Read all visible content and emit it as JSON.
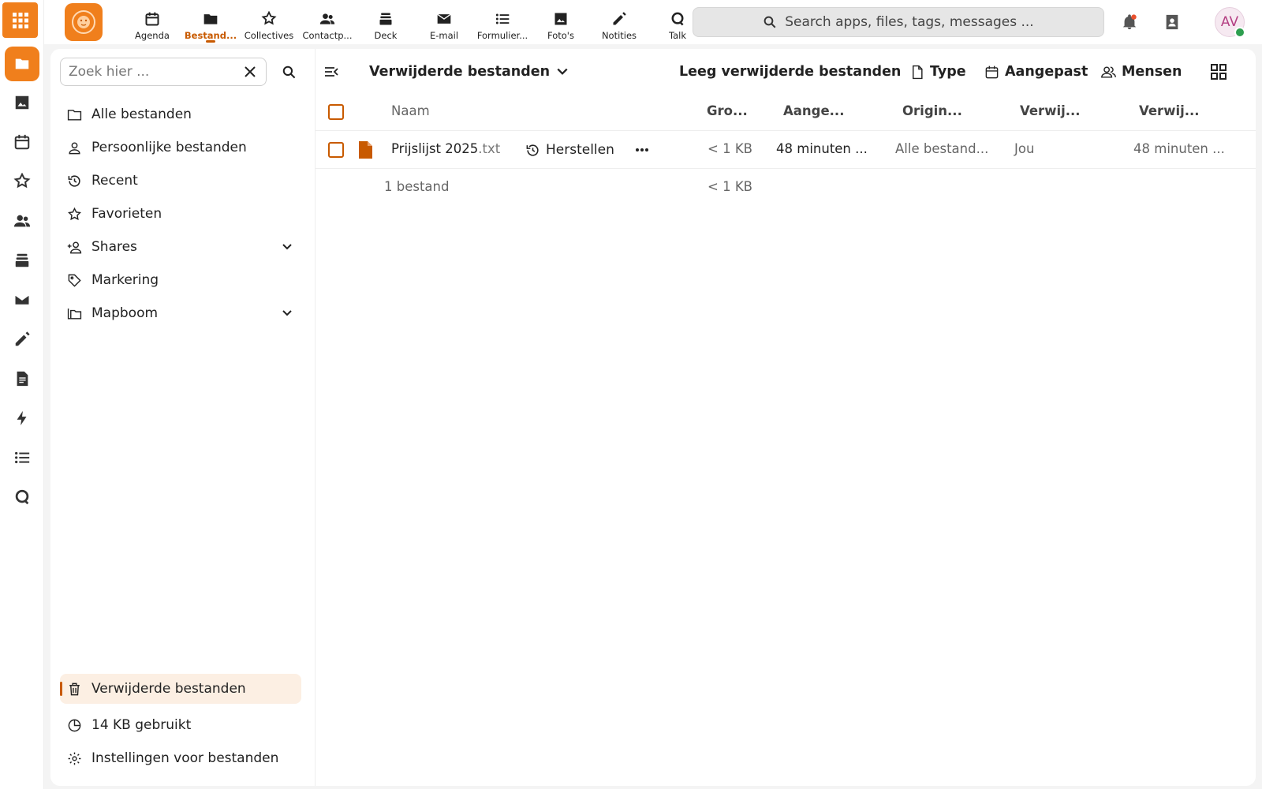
{
  "header": {
    "apps": [
      {
        "label": "Agenda",
        "icon": "calendar-icon"
      },
      {
        "label": "Bestand...",
        "icon": "folder-icon",
        "active": true
      },
      {
        "label": "Collectives",
        "icon": "collectives-icon"
      },
      {
        "label": "Contactp...",
        "icon": "contacts-icon"
      },
      {
        "label": "Deck",
        "icon": "deck-icon"
      },
      {
        "label": "E-mail",
        "icon": "mail-icon"
      },
      {
        "label": "Formulier...",
        "icon": "forms-icon"
      },
      {
        "label": "Foto's",
        "icon": "photos-icon"
      },
      {
        "label": "Notities",
        "icon": "pencil-icon"
      },
      {
        "label": "Talk",
        "icon": "talk-icon"
      }
    ],
    "search_placeholder": "Search apps, files, tags, messages ...",
    "avatar_initials": "AV"
  },
  "sidebar": {
    "filter_placeholder": "Zoek hier ...",
    "items": [
      {
        "label": "Alle bestanden",
        "icon": "folder-icon"
      },
      {
        "label": "Persoonlijke bestanden",
        "icon": "person-icon"
      },
      {
        "label": "Recent",
        "icon": "history-icon"
      },
      {
        "label": "Favorieten",
        "icon": "star-icon"
      },
      {
        "label": "Shares",
        "icon": "share-icon"
      },
      {
        "label": "Markering",
        "icon": "tag-icon"
      },
      {
        "label": "Mapboom",
        "icon": "folder-tree-icon"
      }
    ],
    "footer": {
      "trash_label": "Verwijderde bestanden",
      "quota_label": "14 KB gebruikt",
      "settings_label": "Instellingen voor bestanden"
    }
  },
  "content": {
    "view_title": "Verwijderde bestanden",
    "toolbar": {
      "empty_trash": "Leeg verwijderde bestanden",
      "type_filter": "Type",
      "modified_filter": "Aangepast",
      "people_filter": "Mensen"
    },
    "columns": [
      "Naam",
      "Gro...",
      "Aange...",
      "Origin...",
      "Verwij...",
      "Verwij..."
    ],
    "rows": [
      {
        "name": "Prijslijst 2025",
        "ext": ".txt",
        "restore_label": "Herstellen",
        "size": "< 1 KB",
        "modified": "48 minuten ...",
        "original_location": "Alle bestand...",
        "deleted_by": "Jou",
        "deleted_at": "48 minuten ..."
      }
    ],
    "summary": {
      "count": "1 bestand",
      "size": "< 1 KB"
    }
  },
  "colors": {
    "accent": "#c85a00",
    "brand": "#f07f1c"
  }
}
